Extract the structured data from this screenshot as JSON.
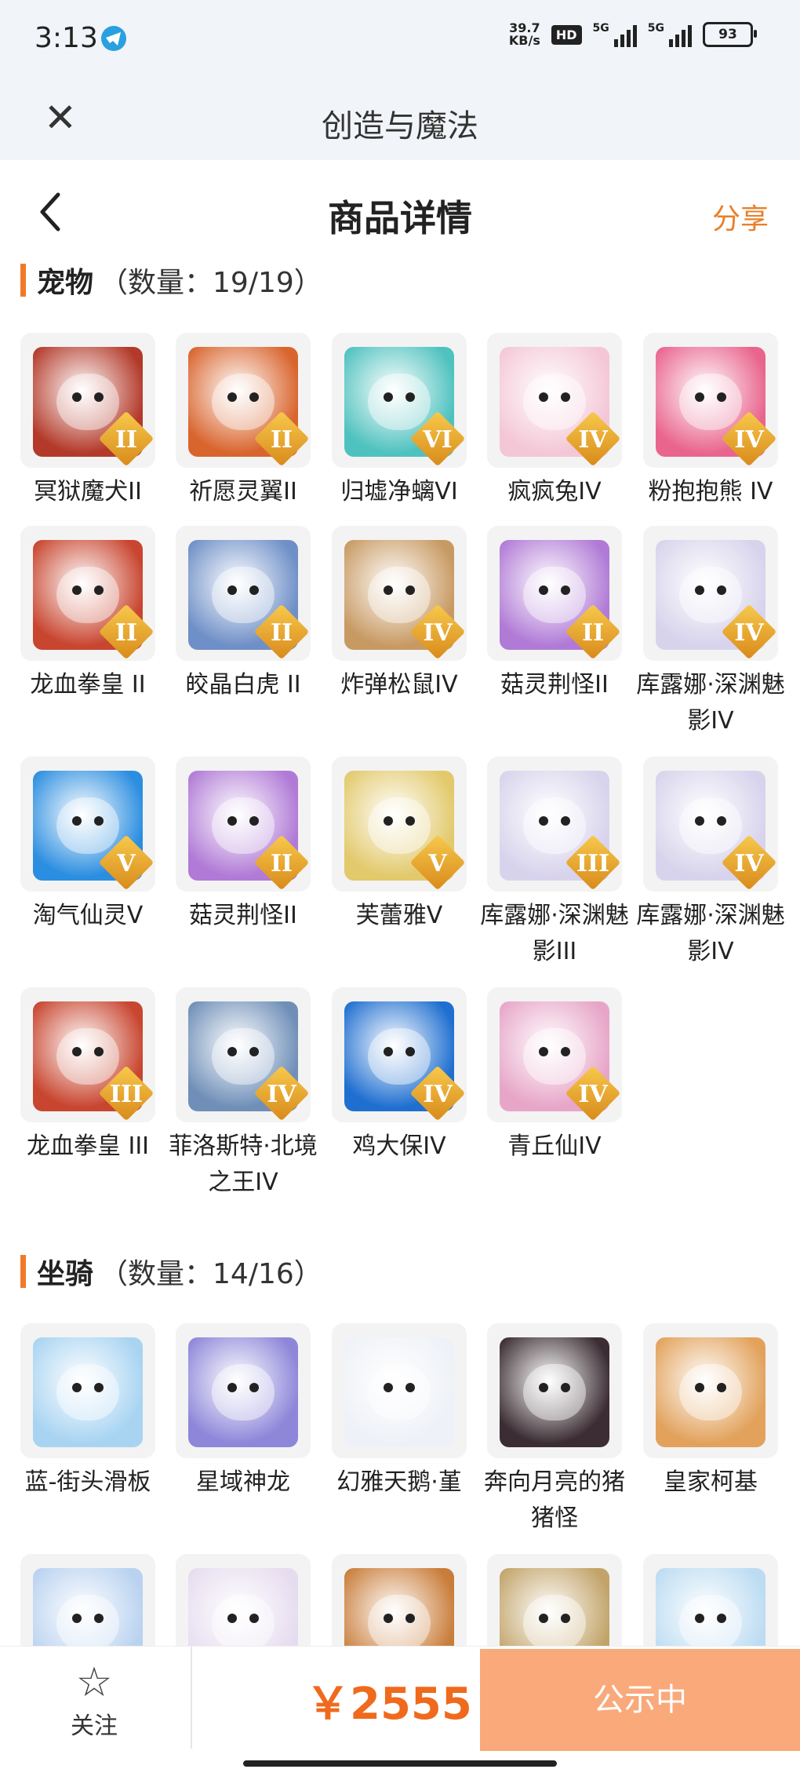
{
  "status_bar": {
    "time": "3:13",
    "speed_value": "39.7",
    "speed_unit": "KB/s",
    "hd": "HD",
    "net1": "5G",
    "net2": "5G",
    "battery": "93"
  },
  "titlebar": {
    "title": "创造与魔法"
  },
  "header": {
    "title": "商品详情",
    "share": "分享"
  },
  "colors": {
    "accent": "#f07a2a",
    "price": "#ef6a1d",
    "publish_bg": "#f9a97a",
    "share": "#e8802b"
  },
  "pets": {
    "name": "宠物",
    "count": "（数量：19/19）",
    "items": [
      {
        "label": "冥狱魔犬II",
        "tier": "II",
        "color": "#b33a2a"
      },
      {
        "label": "祈愿灵翼II",
        "tier": "II",
        "color": "#d9652e"
      },
      {
        "label": "归墟净螭VI",
        "tier": "VI",
        "color": "#4fc2bf"
      },
      {
        "label": "疯疯兔IV",
        "tier": "IV",
        "color": "#f4c7d7"
      },
      {
        "label": "粉抱抱熊 IV",
        "tier": "IV",
        "color": "#e9658e"
      },
      {
        "label": "龙血拳皇 II",
        "tier": "II",
        "color": "#c8452f"
      },
      {
        "label": "皎晶白虎 II",
        "tier": "II",
        "color": "#6e8fc7"
      },
      {
        "label": "炸弹松鼠IV",
        "tier": "IV",
        "color": "#c89a63"
      },
      {
        "label": "菇灵荆怪II",
        "tier": "II",
        "color": "#b07ad6"
      },
      {
        "label": "库露娜·深渊魅影IV",
        "tier": "IV",
        "color": "#d8d3ec"
      },
      {
        "label": "淘气仙灵V",
        "tier": "V",
        "color": "#2b8ee0"
      },
      {
        "label": "菇灵荆怪II",
        "tier": "II",
        "color": "#b07ad6"
      },
      {
        "label": "芙蕾雅V",
        "tier": "V",
        "color": "#e2c96b"
      },
      {
        "label": "库露娜·深渊魅影III",
        "tier": "III",
        "color": "#d8d3ec"
      },
      {
        "label": "库露娜·深渊魅影IV",
        "tier": "IV",
        "color": "#d8d3ec"
      },
      {
        "label": "龙血拳皇 III",
        "tier": "III",
        "color": "#c8452f"
      },
      {
        "label": "菲洛斯特·北境之王IV",
        "tier": "IV",
        "color": "#6f8fb8"
      },
      {
        "label": "鸡大保IV",
        "tier": "IV",
        "color": "#1f6fd0"
      },
      {
        "label": "青丘仙IV",
        "tier": "IV",
        "color": "#e7a6c8"
      }
    ]
  },
  "mounts": {
    "name": "坐骑",
    "count": "（数量：14/16）",
    "items": [
      {
        "label": "蓝-街头滑板",
        "color": "#a8d4f2"
      },
      {
        "label": "星域神龙",
        "color": "#8d86d9"
      },
      {
        "label": "幻雅天鹅·堇",
        "color": "#eef1f7"
      },
      {
        "label": "奔向月亮的猪猪怪",
        "color": "#3b2d33"
      },
      {
        "label": "皇家柯基",
        "color": "#e2a25c"
      },
      {
        "label": "",
        "color": "#b9d2f0"
      },
      {
        "label": "",
        "color": "#e6dcef"
      },
      {
        "label": "",
        "color": "#c97d3a"
      },
      {
        "label": "",
        "color": "#c2a46a"
      },
      {
        "label": "",
        "color": "#bcdcf2"
      }
    ]
  },
  "bottom": {
    "follow": "关注",
    "price": "￥2555",
    "status": "公示中"
  }
}
